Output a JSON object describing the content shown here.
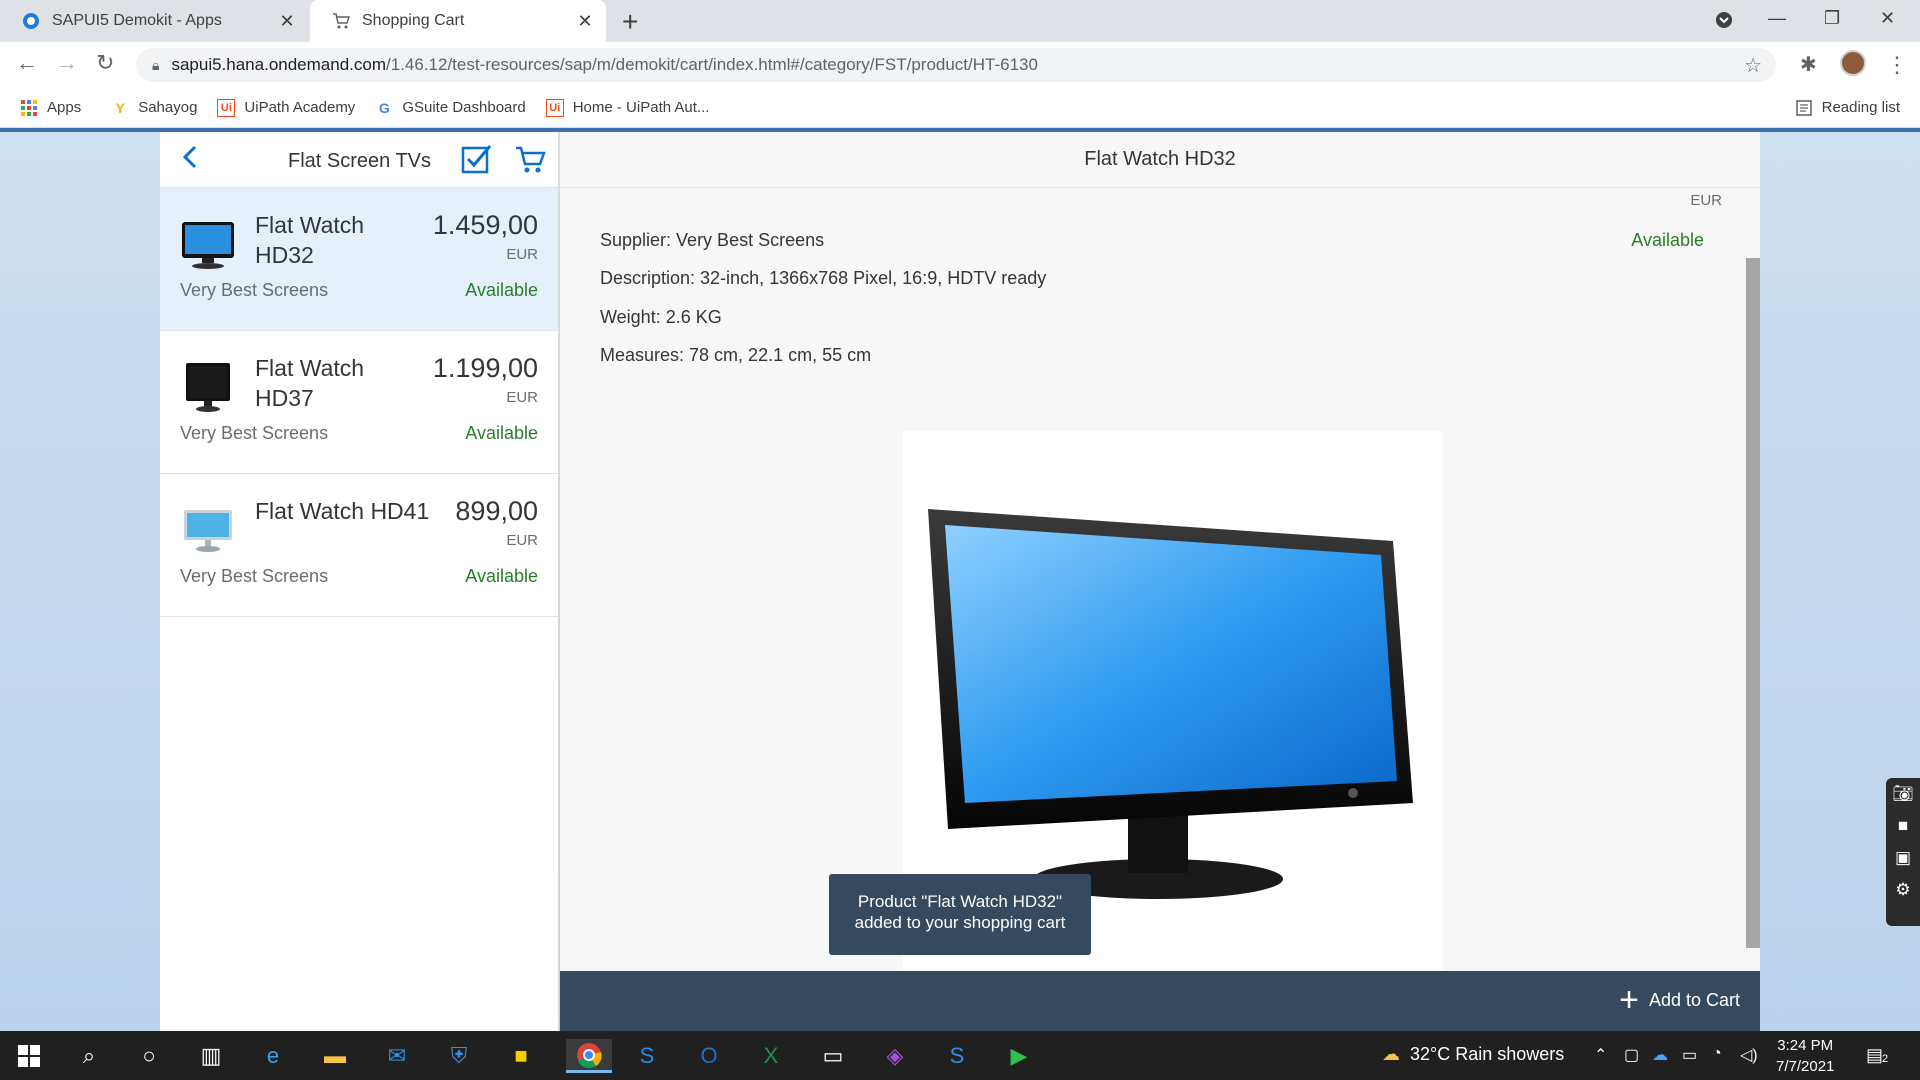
{
  "browser": {
    "tabs": [
      {
        "title": "SAPUI5 Demokit - Apps",
        "icon": "sapui5-logo-icon"
      },
      {
        "title": "Shopping Cart",
        "icon": "cart-icon"
      }
    ],
    "url_host": "sapui5.hana.ondemand.com",
    "url_path": "/1.46.12/test-resources/sap/m/demokit/cart/index.html#/category/FST/product/HT-6130",
    "bookmarks": [
      "Apps",
      "Sahayog",
      "UiPath Academy",
      "GSuite Dashboard",
      "Home - UiPath Aut..."
    ],
    "reading_list": "Reading list"
  },
  "master": {
    "title": "Flat Screen TVs",
    "items": [
      {
        "name": "Flat Watch HD32",
        "price": "1.459,00",
        "currency": "EUR",
        "supplier": "Very Best Screens",
        "status": "Available"
      },
      {
        "name": "Flat Watch HD37",
        "price": "1.199,00",
        "currency": "EUR",
        "supplier": "Very Best Screens",
        "status": "Available"
      },
      {
        "name": "Flat Watch HD41",
        "price": "899,00",
        "currency": "EUR",
        "supplier": "Very Best Screens",
        "status": "Available"
      }
    ]
  },
  "detail": {
    "title": "Flat Watch HD32",
    "currency": "EUR",
    "status": "Available",
    "supplier": "Supplier: Very Best Screens",
    "description": "Description: 32-inch, 1366x768 Pixel, 16:9, HDTV ready",
    "weight": "Weight: 2.6 KG",
    "measures": "Measures: 78 cm, 22.1 cm, 55 cm",
    "add_to_cart": "Add to Cart",
    "toast_line1": "Product \"Flat Watch HD32\"",
    "toast_line2": "added to your shopping cart"
  },
  "taskbar": {
    "weather": "32°C  Rain showers",
    "time": "3:24 PM",
    "date": "7/7/2021",
    "notifications": "2"
  },
  "colors": {
    "accent": "#0a6ed1",
    "positive": "#2b7d2b",
    "footer": "#354a5f"
  }
}
